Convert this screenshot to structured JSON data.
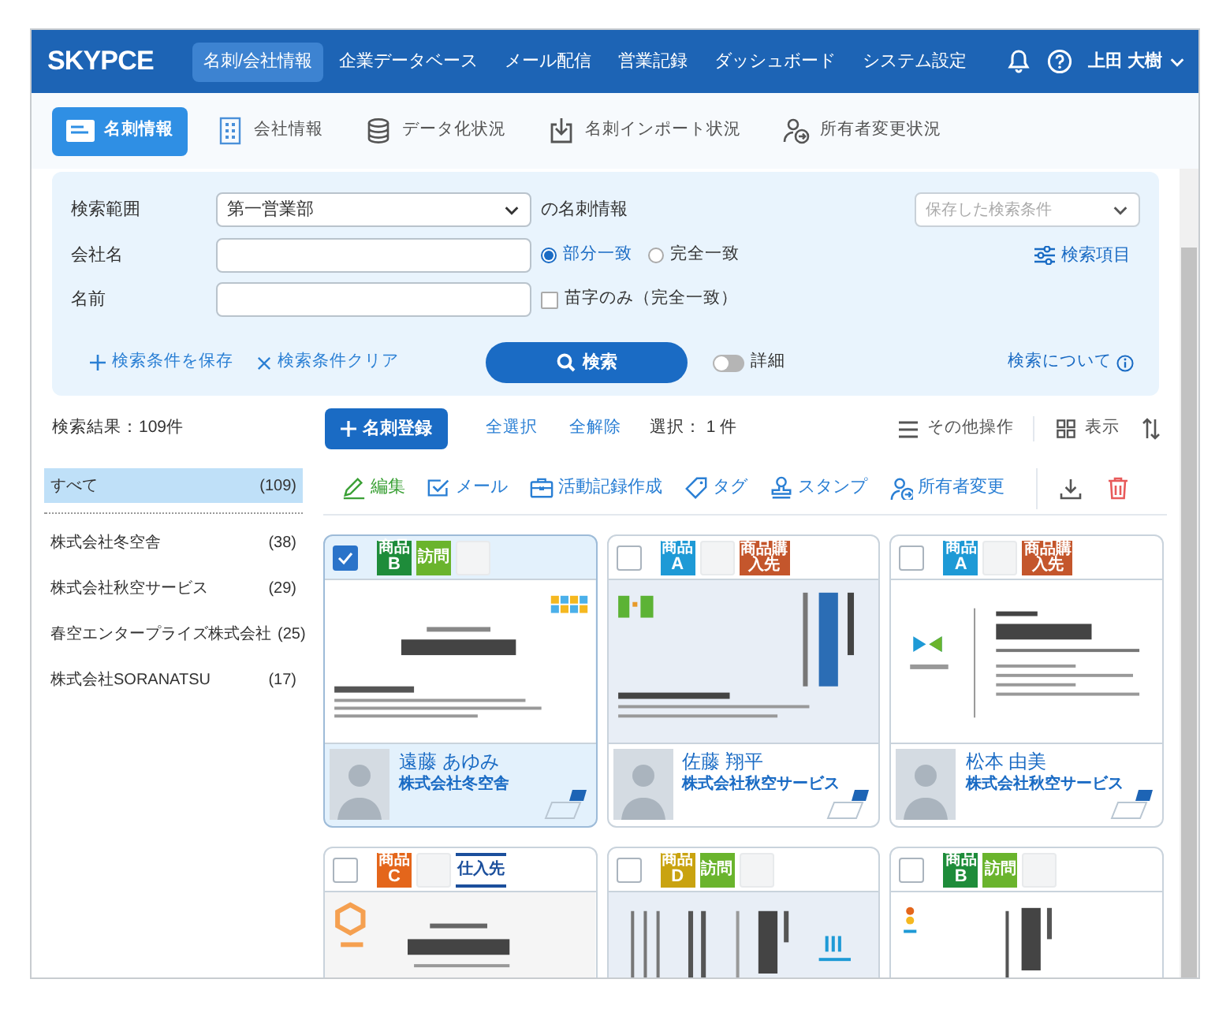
{
  "header": {
    "logo": "SKYPCE",
    "nav": [
      {
        "label": "名刺/会社情報",
        "selected": true
      },
      {
        "label": "企業データベース",
        "selected": false
      },
      {
        "label": "メール配信",
        "selected": false
      },
      {
        "label": "営業記録",
        "selected": false
      },
      {
        "label": "ダッシュボード",
        "selected": false
      },
      {
        "label": "システム設定",
        "selected": false
      }
    ],
    "user": "上田 大樹"
  },
  "subtabs": [
    {
      "label": "名刺情報",
      "kind": "card",
      "selected": true
    },
    {
      "label": "会社情報",
      "kind": "company",
      "selected": false
    },
    {
      "label": "データ化状況",
      "kind": "database",
      "selected": false
    },
    {
      "label": "名刺インポート状況",
      "kind": "import",
      "selected": false
    },
    {
      "label": "所有者変更状況",
      "kind": "owner",
      "selected": false
    }
  ],
  "search": {
    "scope_label": "検索範囲",
    "scope_value": "第一営業部",
    "scope_suffix": "の名刺情報",
    "saved": {
      "placeholder": "保存した検索条件"
    },
    "company_label": "会社名",
    "match_options": [
      {
        "label": "部分一致",
        "selected": true
      },
      {
        "label": "完全一致",
        "selected": false
      }
    ],
    "search_items": "検索項目",
    "name_label": "名前",
    "surname_only": {
      "label": "苗字のみ（完全一致）",
      "checked": false
    },
    "save_link": "検索条件を保存",
    "clear_link": "検索条件クリア",
    "search_button": "検索",
    "detail": {
      "label": "詳細",
      "on": false
    },
    "about": "検索について"
  },
  "results": {
    "count": "検索結果：109件",
    "register": "名刺登録",
    "select_all": "全選択",
    "deselect_all": "全解除",
    "selection": "選択： 1 件",
    "other": "その他操作",
    "view": "表示"
  },
  "sidebar": {
    "items": [
      {
        "label": "すべて",
        "count": "(109)",
        "selected": true
      },
      {
        "label": "株式会社冬空舎",
        "count": "(38)",
        "selected": false
      },
      {
        "label": "株式会社秋空サービス",
        "count": "(29)",
        "selected": false
      },
      {
        "label": "春空エンタープライズ株式会社",
        "count": "(25)",
        "selected": false
      },
      {
        "label": "株式会社SORANATSU",
        "count": "(17)",
        "selected": false
      }
    ]
  },
  "actions": [
    {
      "label": "編集",
      "kind": "edit"
    },
    {
      "label": "メール",
      "kind": "mail"
    },
    {
      "label": "活動記録作成",
      "kind": "activity"
    },
    {
      "label": "タグ",
      "kind": "tag"
    },
    {
      "label": "スタンプ",
      "kind": "stamp"
    },
    {
      "label": "所有者変更",
      "kind": "owner"
    }
  ],
  "cards": [
    {
      "checked": true,
      "kind": "center",
      "tags": [
        {
          "kind": "letter",
          "label": "商品",
          "letter": "B",
          "color": "#1e8c3a"
        },
        {
          "kind": "text",
          "label": "訪問",
          "color": "#6ab42d"
        },
        {
          "kind": "empty"
        }
      ],
      "photo": true,
      "name": "遠藤 あゆみ",
      "company": "株式会社冬空舎"
    },
    {
      "checked": false,
      "kind": "vertical",
      "tags": [
        {
          "kind": "letter",
          "label": "商品",
          "letter": "A",
          "color": "#1e9ad6"
        },
        {
          "kind": "empty"
        },
        {
          "kind": "text",
          "label": "商品購入先",
          "color": "#c4562c"
        }
      ],
      "photo": true,
      "name": "佐藤 翔平",
      "company": "株式会社秋空サービス"
    },
    {
      "checked": false,
      "kind": "split",
      "tags": [
        {
          "kind": "letter",
          "label": "商品",
          "letter": "A",
          "color": "#1e9ad6"
        },
        {
          "kind": "empty"
        },
        {
          "kind": "text",
          "label": "商品購入先",
          "color": "#c4562c"
        }
      ],
      "photo": true,
      "name": "松本 由美",
      "company": "株式会社秋空サービス"
    },
    {
      "checked": false,
      "kind": "center-left",
      "tags": [
        {
          "kind": "letter",
          "label": "商品",
          "letter": "C",
          "color": "#e4661b"
        },
        {
          "kind": "empty"
        },
        {
          "kind": "outline",
          "label": "仕入先",
          "color": "#1b4f9c"
        }
      ]
    },
    {
      "checked": false,
      "kind": "vertical-bars",
      "tags": [
        {
          "kind": "letter",
          "label": "商品",
          "letter": "D",
          "color": "#c9a310"
        },
        {
          "kind": "text",
          "label": "訪問",
          "color": "#6ab42d"
        },
        {
          "kind": "empty"
        }
      ]
    },
    {
      "checked": false,
      "kind": "vertical-dots",
      "tags": [
        {
          "kind": "letter",
          "label": "商品",
          "letter": "B",
          "color": "#1e8c3a"
        },
        {
          "kind": "text",
          "label": "訪問",
          "color": "#6ab42d"
        },
        {
          "kind": "empty"
        }
      ]
    }
  ]
}
